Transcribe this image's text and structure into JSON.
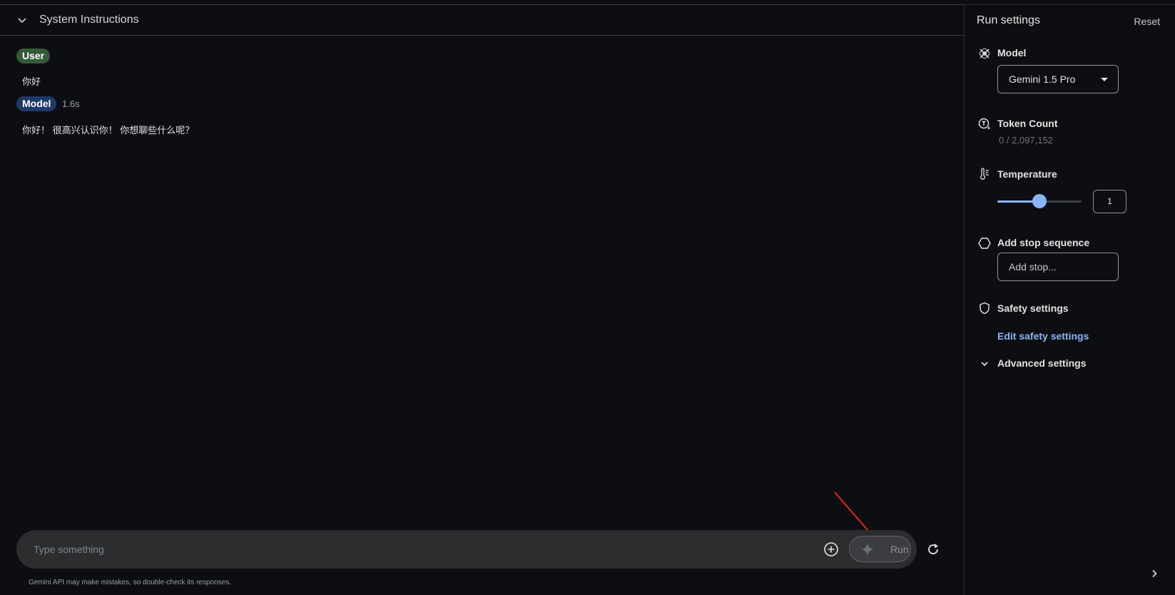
{
  "header": {
    "system_instructions_label": "System Instructions"
  },
  "conversation": {
    "messages": [
      {
        "role": "User",
        "text": "你好"
      },
      {
        "role": "Model",
        "elapsed": "1.6s",
        "text": "你好！ 很高兴认识你！ 你想聊些什么呢？"
      }
    ]
  },
  "composer": {
    "placeholder": "Type something",
    "run_label": "Run",
    "disclaimer": "Gemini API may make mistakes, so double-check its responses."
  },
  "run_settings": {
    "title": "Run settings",
    "reset_label": "Reset",
    "model": {
      "label": "Model",
      "selected": "Gemini 1.5 Pro"
    },
    "token_count": {
      "label": "Token Count",
      "value": "0 / 2,097,152"
    },
    "temperature": {
      "label": "Temperature",
      "value": "1",
      "level_fraction": 0.5
    },
    "stop_sequence": {
      "label": "Add stop sequence",
      "placeholder": "Add stop..."
    },
    "safety": {
      "label": "Safety settings",
      "link": "Edit safety settings"
    },
    "advanced": {
      "label": "Advanced settings"
    }
  },
  "colors": {
    "background": "#0d0e11",
    "accent": "#8ab4f8",
    "user_chip": "#355a3a",
    "model_chip": "#1e3a68",
    "annotation_arrow": "#e8251e"
  },
  "icons": [
    "chevron-down-icon",
    "add-circle-icon",
    "sparkle-icon",
    "refresh-icon",
    "model-icon",
    "token-icon",
    "thermometer-icon",
    "stop-hexagon-icon",
    "shield-icon",
    "chevron-right-icon"
  ]
}
